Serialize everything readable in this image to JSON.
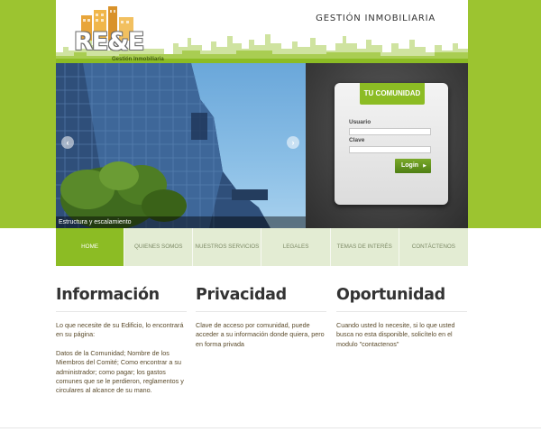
{
  "header": {
    "logo_text": "RE&E",
    "logo_subtitle": "Gestión Inmobiliaria",
    "brand_title": "GESTIÓN INMOBILIARIA"
  },
  "hero": {
    "caption": "Estructura y escalamiento",
    "prev_icon": "chevron-left-icon",
    "next_icon": "chevron-right-icon"
  },
  "login": {
    "title": "TU COMUNIDAD",
    "user_label": "Usuario",
    "user_value": "",
    "password_label": "Clave",
    "password_value": "",
    "button_label": "Login"
  },
  "nav": {
    "items": [
      {
        "label": "HOME",
        "active": true
      },
      {
        "label": "QUIENES SOMOS",
        "active": false
      },
      {
        "label": "NUESTROS SERVICIOS",
        "active": false
      },
      {
        "label": "LEGALES",
        "active": false
      },
      {
        "label": "TEMAS DE INTERÉS",
        "active": false
      },
      {
        "label": "CONTÁCTENOS",
        "active": false
      }
    ]
  },
  "columns": [
    {
      "title": "Información",
      "paragraphs": [
        "Lo que necesite de su Edificio, lo encontrará en su página:",
        "Datos de la Comunidad; Nombre de los Miembros del Comité; Como encontrar a su administrador; como pagar; los gastos comunes que se le perdieron, reglamentos y circulares al alcance de su mano."
      ]
    },
    {
      "title": "Privacidad",
      "paragraphs": [
        "Clave de acceso por comunidad, puede acceder a su información donde quiera, pero en forma privada"
      ]
    },
    {
      "title": "Oportunidad",
      "paragraphs": [
        "Cuando usted lo necesite, si lo que usted busca no esta disponible, solicítelo en el modulo \"contactenos\""
      ]
    }
  ],
  "colors": {
    "accent_green": "#8cbc24",
    "band_green": "#9cc430",
    "nav_inactive": "#e3ecd3",
    "panel_dark": "#3b3b3b"
  }
}
